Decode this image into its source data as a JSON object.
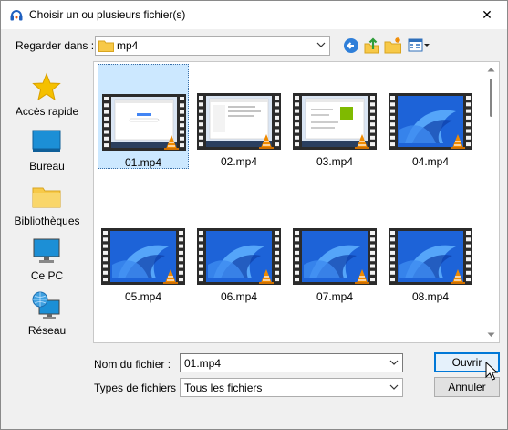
{
  "window": {
    "title": "Choisir un ou plusieurs fichier(s)",
    "close_glyph": "✕"
  },
  "lookin": {
    "label": "Regarder dans :",
    "value": "mp4"
  },
  "places": [
    {
      "label": "Accès rapide",
      "icon": "star-icon"
    },
    {
      "label": "Bureau",
      "icon": "desktop-icon"
    },
    {
      "label": "Bibliothèques",
      "icon": "library-folder-icon"
    },
    {
      "label": "Ce PC",
      "icon": "computer-icon"
    },
    {
      "label": "Réseau",
      "icon": "network-icon"
    }
  ],
  "files": [
    {
      "name": "01.mp4",
      "thumb": "browser"
    },
    {
      "name": "02.mp4",
      "thumb": "window"
    },
    {
      "name": "03.mp4",
      "thumb": "store"
    },
    {
      "name": "04.mp4",
      "thumb": "bloom"
    },
    {
      "name": "05.mp4",
      "thumb": "bloom"
    },
    {
      "name": "06.mp4",
      "thumb": "bloom"
    },
    {
      "name": "07.mp4",
      "thumb": "bloom"
    },
    {
      "name": "08.mp4",
      "thumb": "bloom"
    }
  ],
  "filename": {
    "label": "Nom du fichier :",
    "value": "01.mp4"
  },
  "filetype": {
    "label": "Types de fichiers :",
    "value": "Tous les fichiers"
  },
  "buttons": {
    "open": "Ouvrir",
    "cancel": "Annuler"
  },
  "colors": {
    "accent": "#0078d7",
    "selection": "#cce8ff",
    "folder": "#f7c948",
    "vlc_orange": "#f08a00"
  }
}
